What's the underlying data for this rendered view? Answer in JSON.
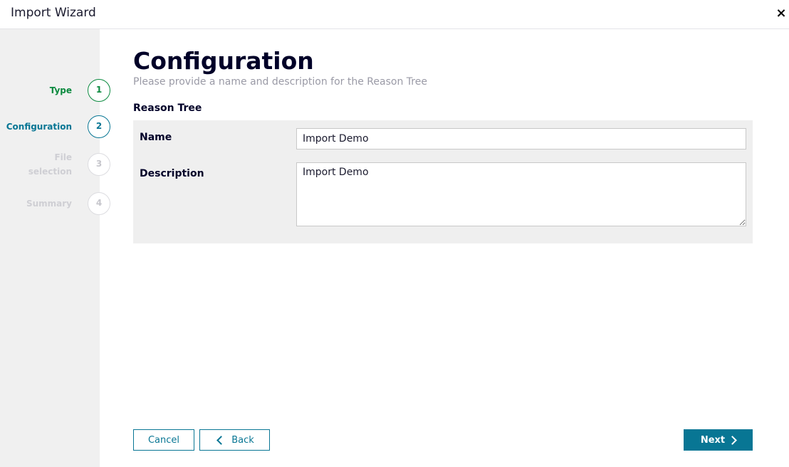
{
  "window": {
    "title": "Import Wizard",
    "close_glyph": "×"
  },
  "stepper": {
    "steps": [
      {
        "label": "Type",
        "number": "1",
        "state": "done"
      },
      {
        "label": "Configuration",
        "number": "2",
        "state": "active"
      },
      {
        "label": "File selection",
        "number": "3",
        "state": "todo"
      },
      {
        "label": "Summary",
        "number": "4",
        "state": "todo"
      }
    ]
  },
  "page": {
    "title": "Configuration",
    "subtitle": "Please provide a name and description for the Reason Tree",
    "section_title": "Reason Tree"
  },
  "form": {
    "name_label": "Name",
    "name_value": "Import Demo",
    "description_label": "Description",
    "description_value": "Import Demo"
  },
  "footer": {
    "cancel_label": "Cancel",
    "back_label": "Back",
    "next_label": "Next"
  },
  "colors": {
    "accent": "#087694",
    "done": "#0b8a3f",
    "pending": "#cfcfd4",
    "sidebar_bg": "#f0f0f0",
    "panel_bg": "#efefef"
  }
}
